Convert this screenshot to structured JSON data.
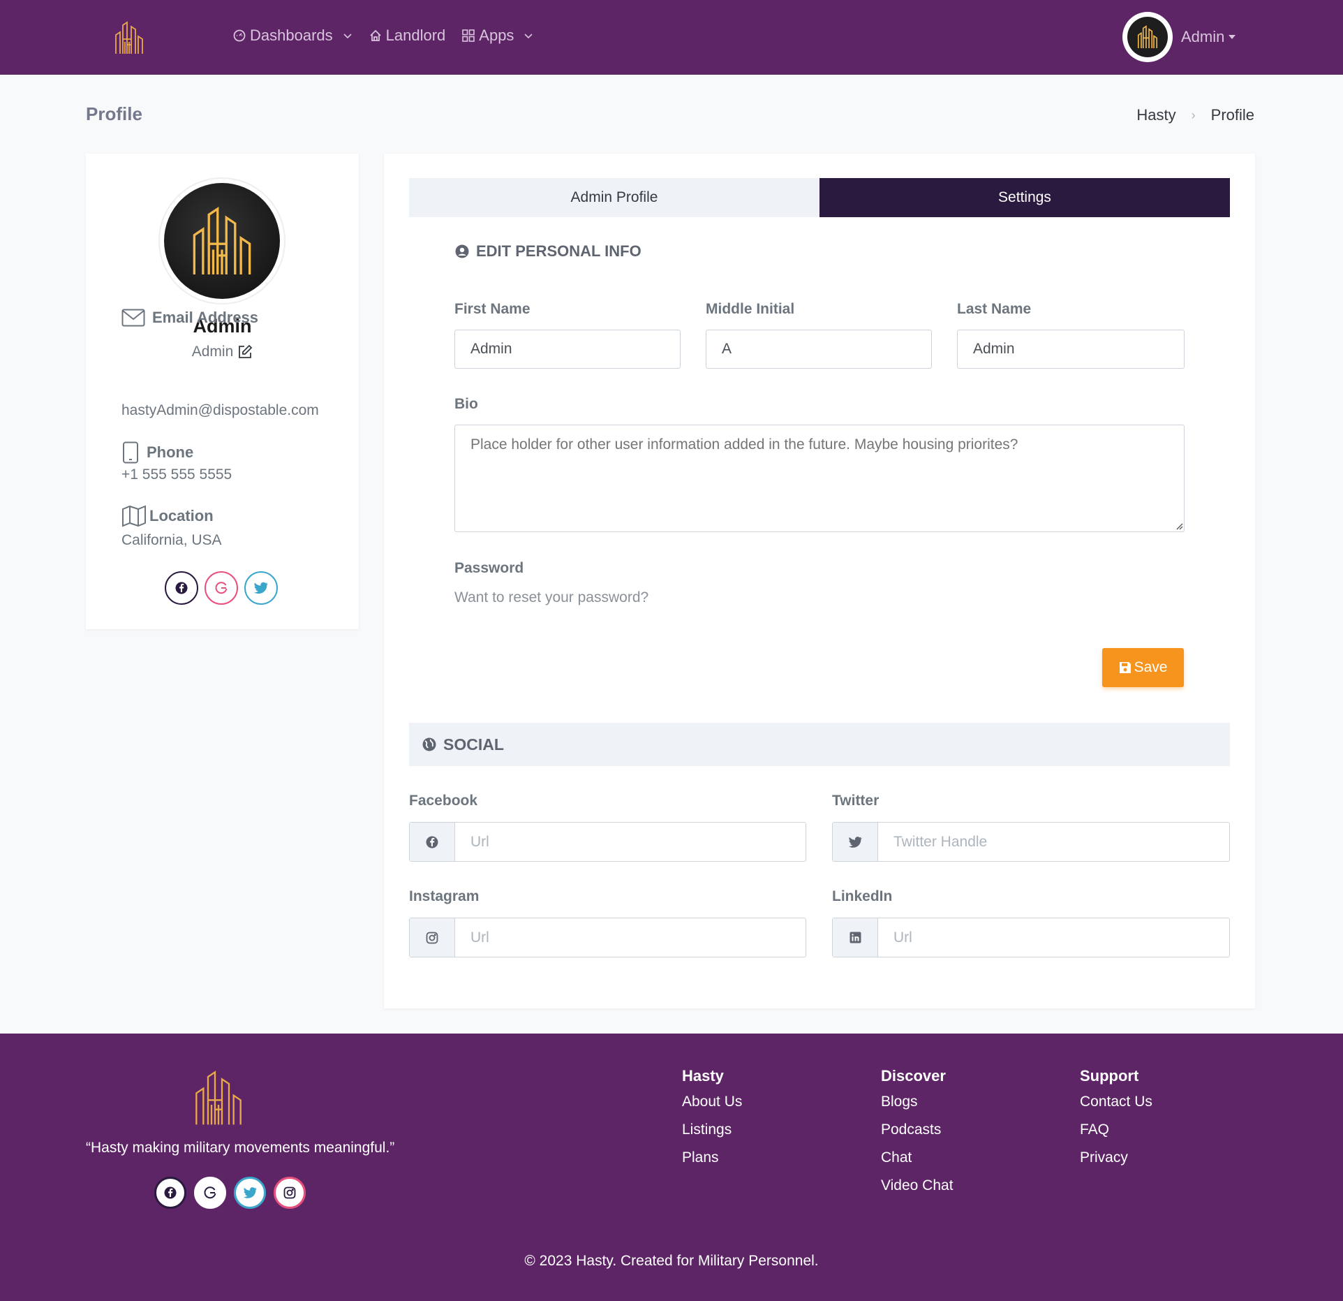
{
  "nav": {
    "menu": [
      {
        "label": "Dashboards",
        "icon": "dashboard-icon",
        "has_dropdown": true
      },
      {
        "label": "Landlord",
        "icon": "home-icon",
        "has_dropdown": false
      },
      {
        "label": "Apps",
        "icon": "apps-grid-icon",
        "has_dropdown": true
      }
    ],
    "user_name": "Admin"
  },
  "page": {
    "title": "Profile",
    "breadcrumb": [
      "Hasty",
      "Profile"
    ]
  },
  "profile_card": {
    "name": "Admin",
    "role": "Admin",
    "email_label": "Email Address",
    "email": "hastyAdmin@dispostable.com",
    "phone_label": "Phone",
    "phone": "+1 555 555 5555",
    "location_label": "Location",
    "location": "California, USA"
  },
  "tabs": [
    "Admin Profile",
    "Settings"
  ],
  "active_tab": "Settings",
  "edit_info": {
    "heading": "EDIT PERSONAL INFO",
    "first_name_label": "First Name",
    "first_name": "Admin",
    "middle_initial_label": "Middle Initial",
    "middle_initial": "A",
    "last_name_label": "Last Name",
    "last_name": "Admin",
    "bio_label": "Bio",
    "bio_placeholder": "Place holder for other user information added in the future. Maybe housing priorites?",
    "password_label": "Password",
    "password_link": "Want to reset your password?",
    "save_label": "Save"
  },
  "social": {
    "heading": "SOCIAL",
    "facebook_label": "Facebook",
    "facebook_placeholder": "Url",
    "twitter_label": "Twitter",
    "twitter_placeholder": "Twitter Handle",
    "instagram_label": "Instagram",
    "instagram_placeholder": "Url",
    "linkedin_label": "LinkedIn",
    "linkedin_placeholder": "Url"
  },
  "footer": {
    "quote": "“Hasty making military movements meaningful.”",
    "columns": [
      {
        "heading": "Hasty",
        "links": [
          "About Us",
          "Listings",
          "Plans"
        ]
      },
      {
        "heading": "Discover",
        "links": [
          "Blogs",
          "Podcasts",
          "Chat",
          "Video Chat"
        ]
      },
      {
        "heading": "Support",
        "links": [
          "Contact Us",
          "FAQ",
          "Privacy"
        ]
      }
    ],
    "copyright": "© 2023 Hasty. Created for Military Personnel."
  },
  "colors": {
    "brand_purple": "#5d2566",
    "dark_tab": "#2b1a40",
    "save_orange": "#f7941d",
    "logo_gold": "#f2b84b"
  }
}
